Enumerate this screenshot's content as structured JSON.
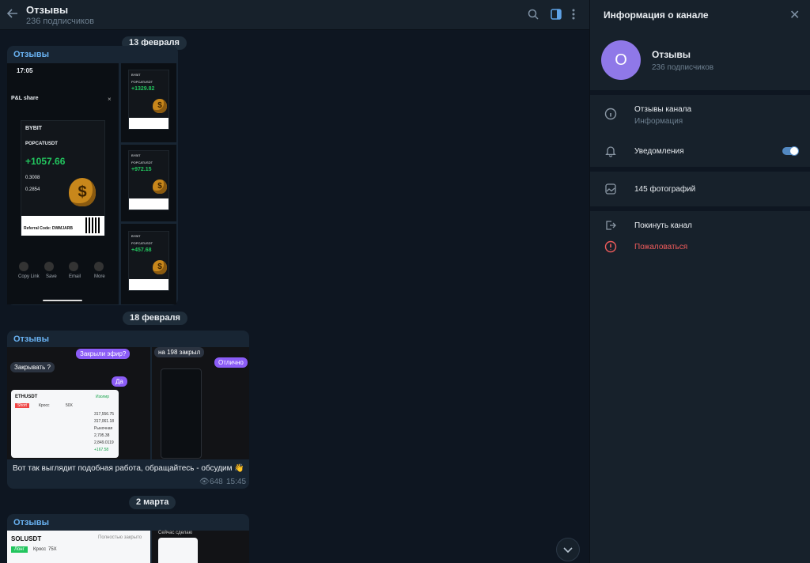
{
  "header": {
    "title": "Отзывы",
    "subtitle": "236 подписчиков"
  },
  "dates": [
    "13 февраля",
    "18 февраля",
    "2 марта"
  ],
  "posts": [
    {
      "author": "Отзывы",
      "phone": {
        "time": "17:05",
        "share": "P&L share",
        "brand": "BYBIT",
        "pair": "POPCATUSDT",
        "pnl": "+1057.66",
        "entry": "0.3008",
        "exit": "0.2854",
        "referral": "Referral Code: DWMJARB",
        "actions": [
          "Copy Link",
          "Save",
          "Email",
          "More"
        ]
      },
      "thumbs": [
        {
          "pair": "POPCATUSDT",
          "pnl": "+1329.82"
        },
        {
          "pair": "POPCATUSDT",
          "pnl": "+972.15"
        },
        {
          "pair": "POPCATUSDT",
          "pnl": "+457.68"
        }
      ]
    },
    {
      "author": "Отзывы",
      "bubbles": [
        "Закрыли эфир?",
        "Закрывать ?",
        "Да",
        "на 198 закрыл",
        "Отлично"
      ],
      "card": {
        "pair": "ETHUSDT",
        "tag1": "Изолир",
        "tag2": "Кросс",
        "lev": "50X",
        "rows": [
          "317,556.75",
          "317,061.18",
          "Рыночная",
          "2,795.38",
          "2,849.0119",
          "+167.58"
        ]
      },
      "text": "Вот так выглядит подобная работа, обращайтесь - обсудим 👋",
      "views": "648",
      "time": "15:45"
    },
    {
      "author": "Отзывы",
      "pair": "SOLUSDT",
      "status": "Полностью закрыто",
      "tag1": "Лонг",
      "tag2": "Кросс",
      "lev": "75X",
      "right_caption": "Сейчас сделаю"
    }
  ],
  "panel": {
    "title": "Информация о канале",
    "avatar_letter": "О",
    "name": "Отзывы",
    "subscribers": "236 подписчиков",
    "about_label": "Отзывы канала",
    "about_sub": "Информация",
    "notifications": "Уведомления",
    "notifications_on": true,
    "photos": "145 фотографий",
    "leave": "Покинуть канал",
    "report": "Пожаловаться"
  },
  "colors": {
    "accent": "#6ab3f3",
    "toggle": "#5288c1",
    "danger": "#ef5b5b",
    "avatar": "#8f78e8"
  }
}
